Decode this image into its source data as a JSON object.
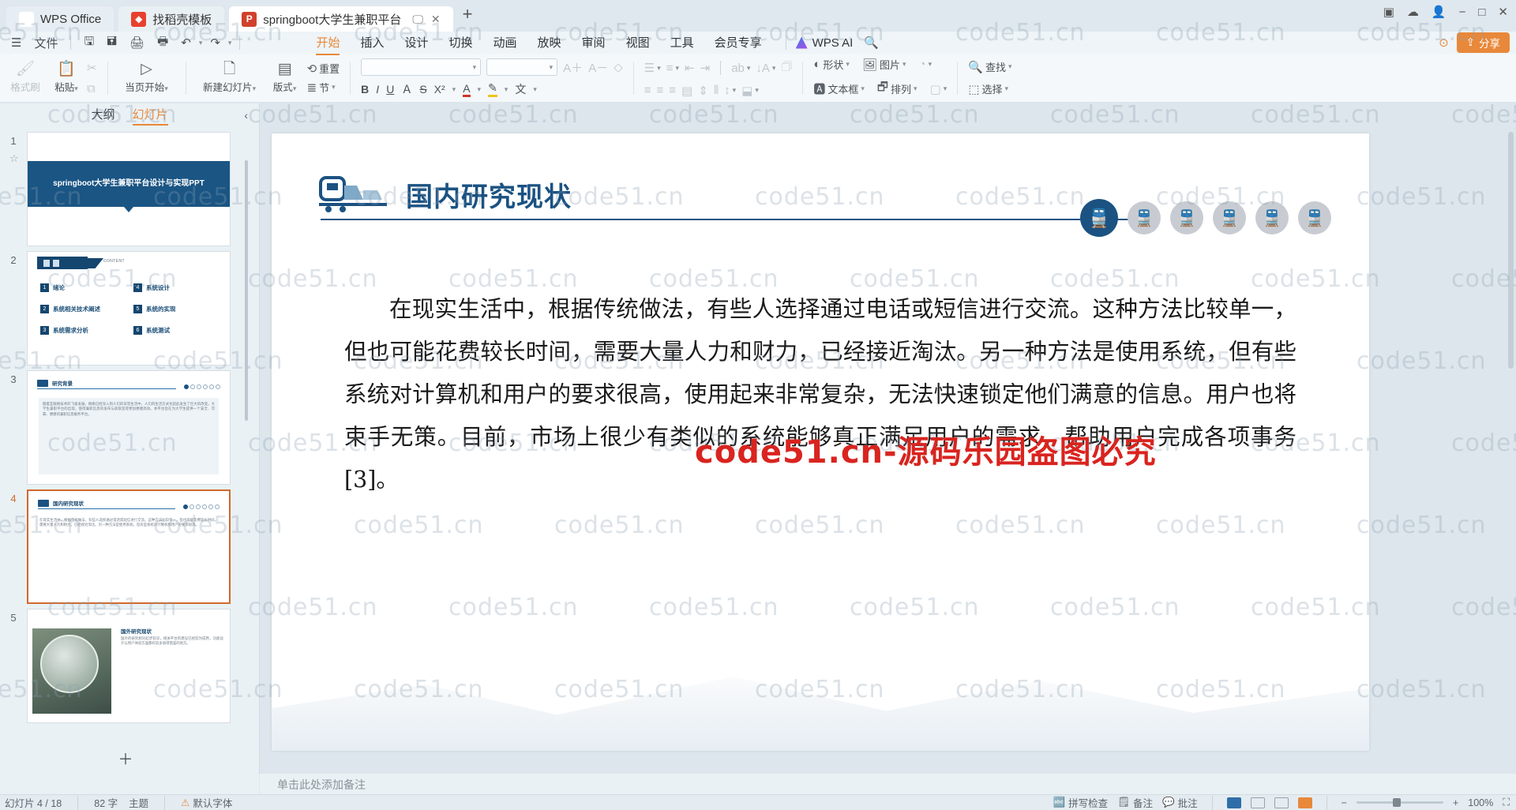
{
  "window": {
    "tabs": [
      {
        "label": "WPS Office",
        "icon": "wps-logo-icon",
        "kind": "wps"
      },
      {
        "label": "找稻壳模板",
        "icon": "docer-icon",
        "kind": "docer"
      },
      {
        "label": "springboot大学生兼职平台",
        "icon": "ppt-file-icon",
        "kind": "ppt",
        "active": true
      }
    ],
    "new_tab": "+",
    "controls": {
      "minimize": "−",
      "maximize": "□",
      "close": "✕",
      "layout": "▤",
      "cloud": "☁"
    }
  },
  "menubar": {
    "file_label": "文件",
    "quick_access": [
      "save-icon",
      "save-as-icon",
      "print-icon",
      "print-preview-icon",
      "undo-icon",
      "redo-icon",
      "customize-icon"
    ],
    "items": [
      {
        "label": "开始",
        "active": true
      },
      {
        "label": "插入",
        "active": false
      },
      {
        "label": "设计",
        "active": false
      },
      {
        "label": "切换",
        "active": false
      },
      {
        "label": "动画",
        "active": false
      },
      {
        "label": "放映",
        "active": false
      },
      {
        "label": "审阅",
        "active": false
      },
      {
        "label": "视图",
        "active": false
      },
      {
        "label": "工具",
        "active": false
      },
      {
        "label": "会员专享",
        "active": false
      }
    ],
    "ai_label": "WPS AI",
    "search_icon": "search-icon",
    "share_label": "分享",
    "help_icon": "help-icon"
  },
  "ribbon": {
    "clipboard": {
      "format_painter": "格式刷",
      "paste": "粘贴",
      "cut": "剪切",
      "copy": "复制"
    },
    "present": {
      "start_here": "当页开始"
    },
    "slides": {
      "new_slide": "新建幻灯片",
      "layout": "版式",
      "section": "节",
      "reset": "重置"
    },
    "font": {
      "font_name_value": "",
      "font_size_value": "",
      "grow": "A＋",
      "shrink": "A－",
      "clear_format": "清除格式",
      "bold": "B",
      "italic": "I",
      "underline": "U",
      "text_effect": "A",
      "strike": "S",
      "superscript": "X²",
      "font_color": "A",
      "highlight": "✎",
      "char_case": "文"
    },
    "paragraph": {
      "bullets": "项目符号",
      "numbering": "编号",
      "decrease_indent": "减少缩进",
      "increase_indent": "增加缩进",
      "pinyin": "ab",
      "sort": "排序",
      "smartart": "智能图形",
      "align_left": "左对齐",
      "align_center": "居中",
      "align_right": "右对齐",
      "justify": "两端对齐",
      "line_spacing": "行距",
      "column": "分栏",
      "text_direction": "文字方向",
      "align_text": "对齐文本"
    },
    "insert": {
      "shapes": "形状",
      "pictures": "图片",
      "icons": "图标",
      "textbox": "文本框",
      "arrange": "排列",
      "quick_style": "快速样式"
    },
    "editing": {
      "find": "查找",
      "select": "选择"
    }
  },
  "left_panel": {
    "tabs": [
      {
        "label": "大纲",
        "active": false
      },
      {
        "label": "幻灯片",
        "active": true
      }
    ],
    "collapse_icon": "chevron-left-icon",
    "add_slide_icon": "plus-icon",
    "slides": [
      {
        "number": "1",
        "title": "springboot大学生兼职平台设计与实现PPT",
        "selected": false
      },
      {
        "number": "2",
        "title": "CONTENT",
        "selected": false,
        "items": [
          {
            "n": "1",
            "label": "绪论"
          },
          {
            "n": "4",
            "label": "系统设计"
          },
          {
            "n": "2",
            "label": "系统相关技术阐述"
          },
          {
            "n": "5",
            "label": "系统的实现"
          },
          {
            "n": "3",
            "label": "系统需求分析"
          },
          {
            "n": "6",
            "label": "系统测试"
          }
        ]
      },
      {
        "number": "3",
        "title": "研究背景",
        "selected": false,
        "body": "随着互联网技术的飞速发展，网络已经深入到人们的日常生活中，人们的生活方式也因此发生了巨大的改变。大学生兼职平台的出现，使得兼职信息的发布与获取变得更加便捷高效。本平台旨在为大学生提供一个安全、可靠、便捷的兼职信息服务平台。"
      },
      {
        "number": "4",
        "title": "国内研究现状",
        "selected": true,
        "body": "在现实生活中，根据传统做法，有些人选择通过电话或短信进行交流。这种方法比较单一，但也可能花费较长时间，需要大量人力和财力，已经接近淘汰。另一种方法是使用系统，但有些系统对计算机和用户的要求很高。"
      },
      {
        "number": "5",
        "title": "国外研究现状",
        "selected": false,
        "body": "国外的研究相对起步较早，相关平台的建设已经较为成熟，功能设计与用户体验方面都有较多值得借鉴的地方。"
      }
    ]
  },
  "slide": {
    "title": "国内研究现状",
    "title_icon": "train-icon",
    "nodes": [
      {
        "active": true
      },
      {
        "active": false
      },
      {
        "active": false
      },
      {
        "active": false
      },
      {
        "active": false
      },
      {
        "active": false
      }
    ],
    "node_icon": "train-node-icon",
    "body": "在现实生活中，根据传统做法，有些人选择通过电话或短信进行交流。这种方法比较单一，但也可能花费较长时间，需要大量人力和财力，已经接近淘汰。另一种方法是使用系统，但有些系统对计算机和用户的要求很高，使用起来非常复杂，无法快速锁定他们满意的信息。用户也将束手无策。目前，市场上很少有类似的系统能够真正满足用户的需求，帮助用户完成各项事务[3]。",
    "accent_color": "#1b5282"
  },
  "watermark": {
    "text": "code51.cn",
    "red_overlay": "code51.cn-源码乐园盗图必究"
  },
  "notes": {
    "placeholder": "单击此处添加备注"
  },
  "statusbar": {
    "slide_indicator": "幻灯片 4 / 18",
    "word_count": "82 字",
    "theme": "主题",
    "default_font": "默认字体",
    "spell_check": "拼写检查",
    "notes_label": "备注",
    "view_label": "批注",
    "zoom_level": "100%",
    "zoom_out": "−",
    "zoom_in": "+"
  }
}
